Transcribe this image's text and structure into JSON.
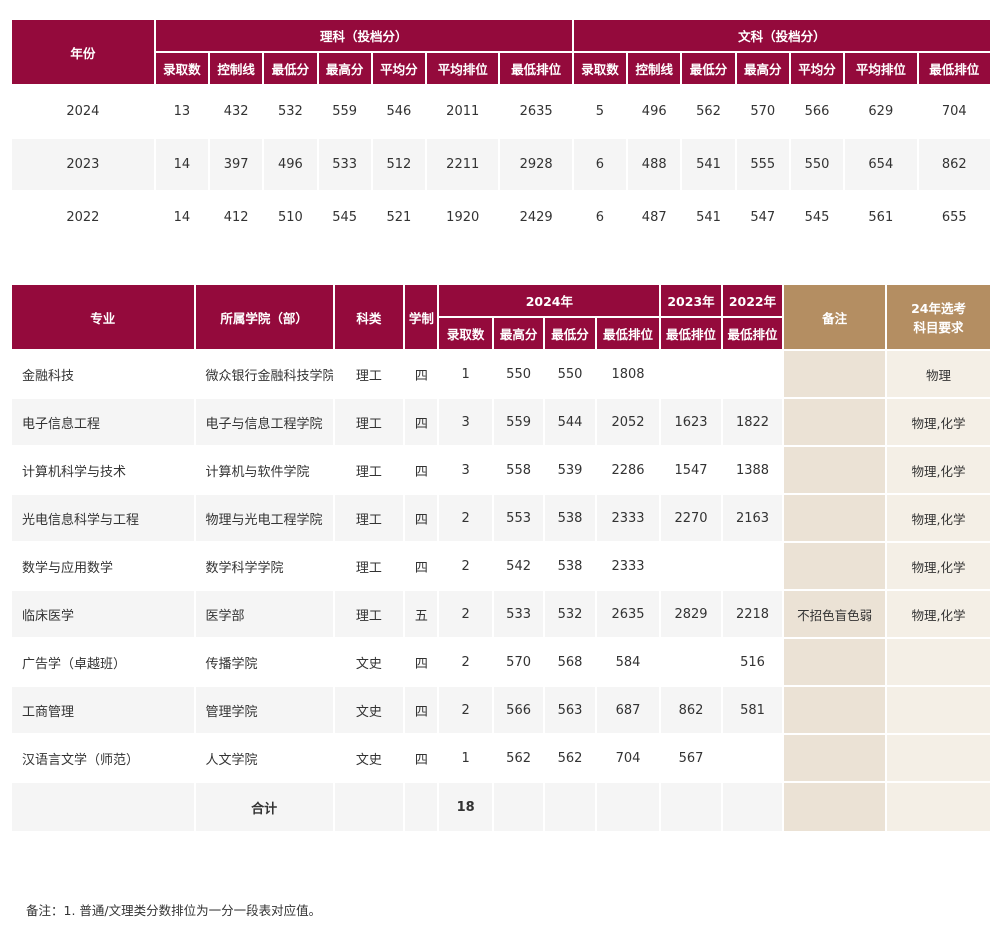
{
  "scores_table": {
    "year_header": "年份",
    "science_header": "理科（投档分）",
    "arts_header": "文科（投档分）",
    "science_columns": [
      "录取数",
      "控制线",
      "最低分",
      "最高分",
      "平均分",
      "平均排位",
      "最低排位"
    ],
    "arts_columns": [
      "录取数",
      "控制线",
      "最低分",
      "最高分",
      "平均分",
      "平均排位",
      "最低排位"
    ],
    "rows": [
      {
        "year": "2024",
        "science": [
          "13",
          "432",
          "532",
          "559",
          "546",
          "2011",
          "2635"
        ],
        "arts": [
          "5",
          "496",
          "562",
          "570",
          "566",
          "629",
          "704"
        ]
      },
      {
        "year": "2023",
        "science": [
          "14",
          "397",
          "496",
          "533",
          "512",
          "2211",
          "2928"
        ],
        "arts": [
          "6",
          "488",
          "541",
          "555",
          "550",
          "654",
          "862"
        ]
      },
      {
        "year": "2022",
        "science": [
          "14",
          "412",
          "510",
          "545",
          "521",
          "1920",
          "2429"
        ],
        "arts": [
          "6",
          "487",
          "541",
          "547",
          "545",
          "561",
          "655"
        ]
      }
    ]
  },
  "majors_table": {
    "headers": {
      "major": "专业",
      "college": "所属学院（部）",
      "category": "科类",
      "duration": "学制",
      "year_2024": "2024年",
      "year_2023": "2023年",
      "year_2022": "2022年",
      "note": "备注",
      "req_line1": "24年选考",
      "req_line2": "科目要求",
      "admitted": "录取数",
      "max_2024": "最高分",
      "min_2024": "最低分",
      "minrank_2024": "最低排位",
      "minrank_2023": "最低排位",
      "minrank_2022": "最低排位"
    },
    "rows": [
      {
        "major": "金融科技",
        "college": "微众银行金融科技学院",
        "category": "理工",
        "duration": "四",
        "admitted": "1",
        "max": "550",
        "min": "550",
        "rank2024": "1808",
        "rank2023": "",
        "rank2022": "",
        "note": "",
        "req": "物理"
      },
      {
        "major": "电子信息工程",
        "college": "电子与信息工程学院",
        "category": "理工",
        "duration": "四",
        "admitted": "3",
        "max": "559",
        "min": "544",
        "rank2024": "2052",
        "rank2023": "1623",
        "rank2022": "1822",
        "note": "",
        "req": "物理,化学"
      },
      {
        "major": "计算机科学与技术",
        "college": "计算机与软件学院",
        "category": "理工",
        "duration": "四",
        "admitted": "3",
        "max": "558",
        "min": "539",
        "rank2024": "2286",
        "rank2023": "1547",
        "rank2022": "1388",
        "note": "",
        "req": "物理,化学"
      },
      {
        "major": "光电信息科学与工程",
        "college": "物理与光电工程学院",
        "category": "理工",
        "duration": "四",
        "admitted": "2",
        "max": "553",
        "min": "538",
        "rank2024": "2333",
        "rank2023": "2270",
        "rank2022": "2163",
        "note": "",
        "req": "物理,化学"
      },
      {
        "major": "数学与应用数学",
        "college": "数学科学学院",
        "category": "理工",
        "duration": "四",
        "admitted": "2",
        "max": "542",
        "min": "538",
        "rank2024": "2333",
        "rank2023": "",
        "rank2022": "",
        "note": "",
        "req": "物理,化学"
      },
      {
        "major": "临床医学",
        "college": "医学部",
        "category": "理工",
        "duration": "五",
        "admitted": "2",
        "max": "533",
        "min": "532",
        "rank2024": "2635",
        "rank2023": "2829",
        "rank2022": "2218",
        "note": "不招色盲色弱",
        "req": "物理,化学"
      },
      {
        "major": "广告学（卓越班）",
        "college": "传播学院",
        "category": "文史",
        "duration": "四",
        "admitted": "2",
        "max": "570",
        "min": "568",
        "rank2024": "584",
        "rank2023": "",
        "rank2022": "516",
        "note": "",
        "req": ""
      },
      {
        "major": "工商管理",
        "college": "管理学院",
        "category": "文史",
        "duration": "四",
        "admitted": "2",
        "max": "566",
        "min": "563",
        "rank2024": "687",
        "rank2023": "862",
        "rank2022": "581",
        "note": "",
        "req": ""
      },
      {
        "major": "汉语言文学（师范）",
        "college": "人文学院",
        "category": "文史",
        "duration": "四",
        "admitted": "1",
        "max": "562",
        "min": "562",
        "rank2024": "704",
        "rank2023": "567",
        "rank2022": "",
        "note": "",
        "req": ""
      }
    ],
    "total_label": "合计",
    "total_admitted": "18"
  },
  "footnote": "备注：1. 普通/文理类分数排位为一分一段表对应值。",
  "colors": {
    "header_maroon": "#940a3c",
    "header_tan": "#b48e62",
    "note_bg": "#ebe2d5",
    "req_bg": "#f4efe6",
    "row_alt": "#f5f5f5"
  }
}
